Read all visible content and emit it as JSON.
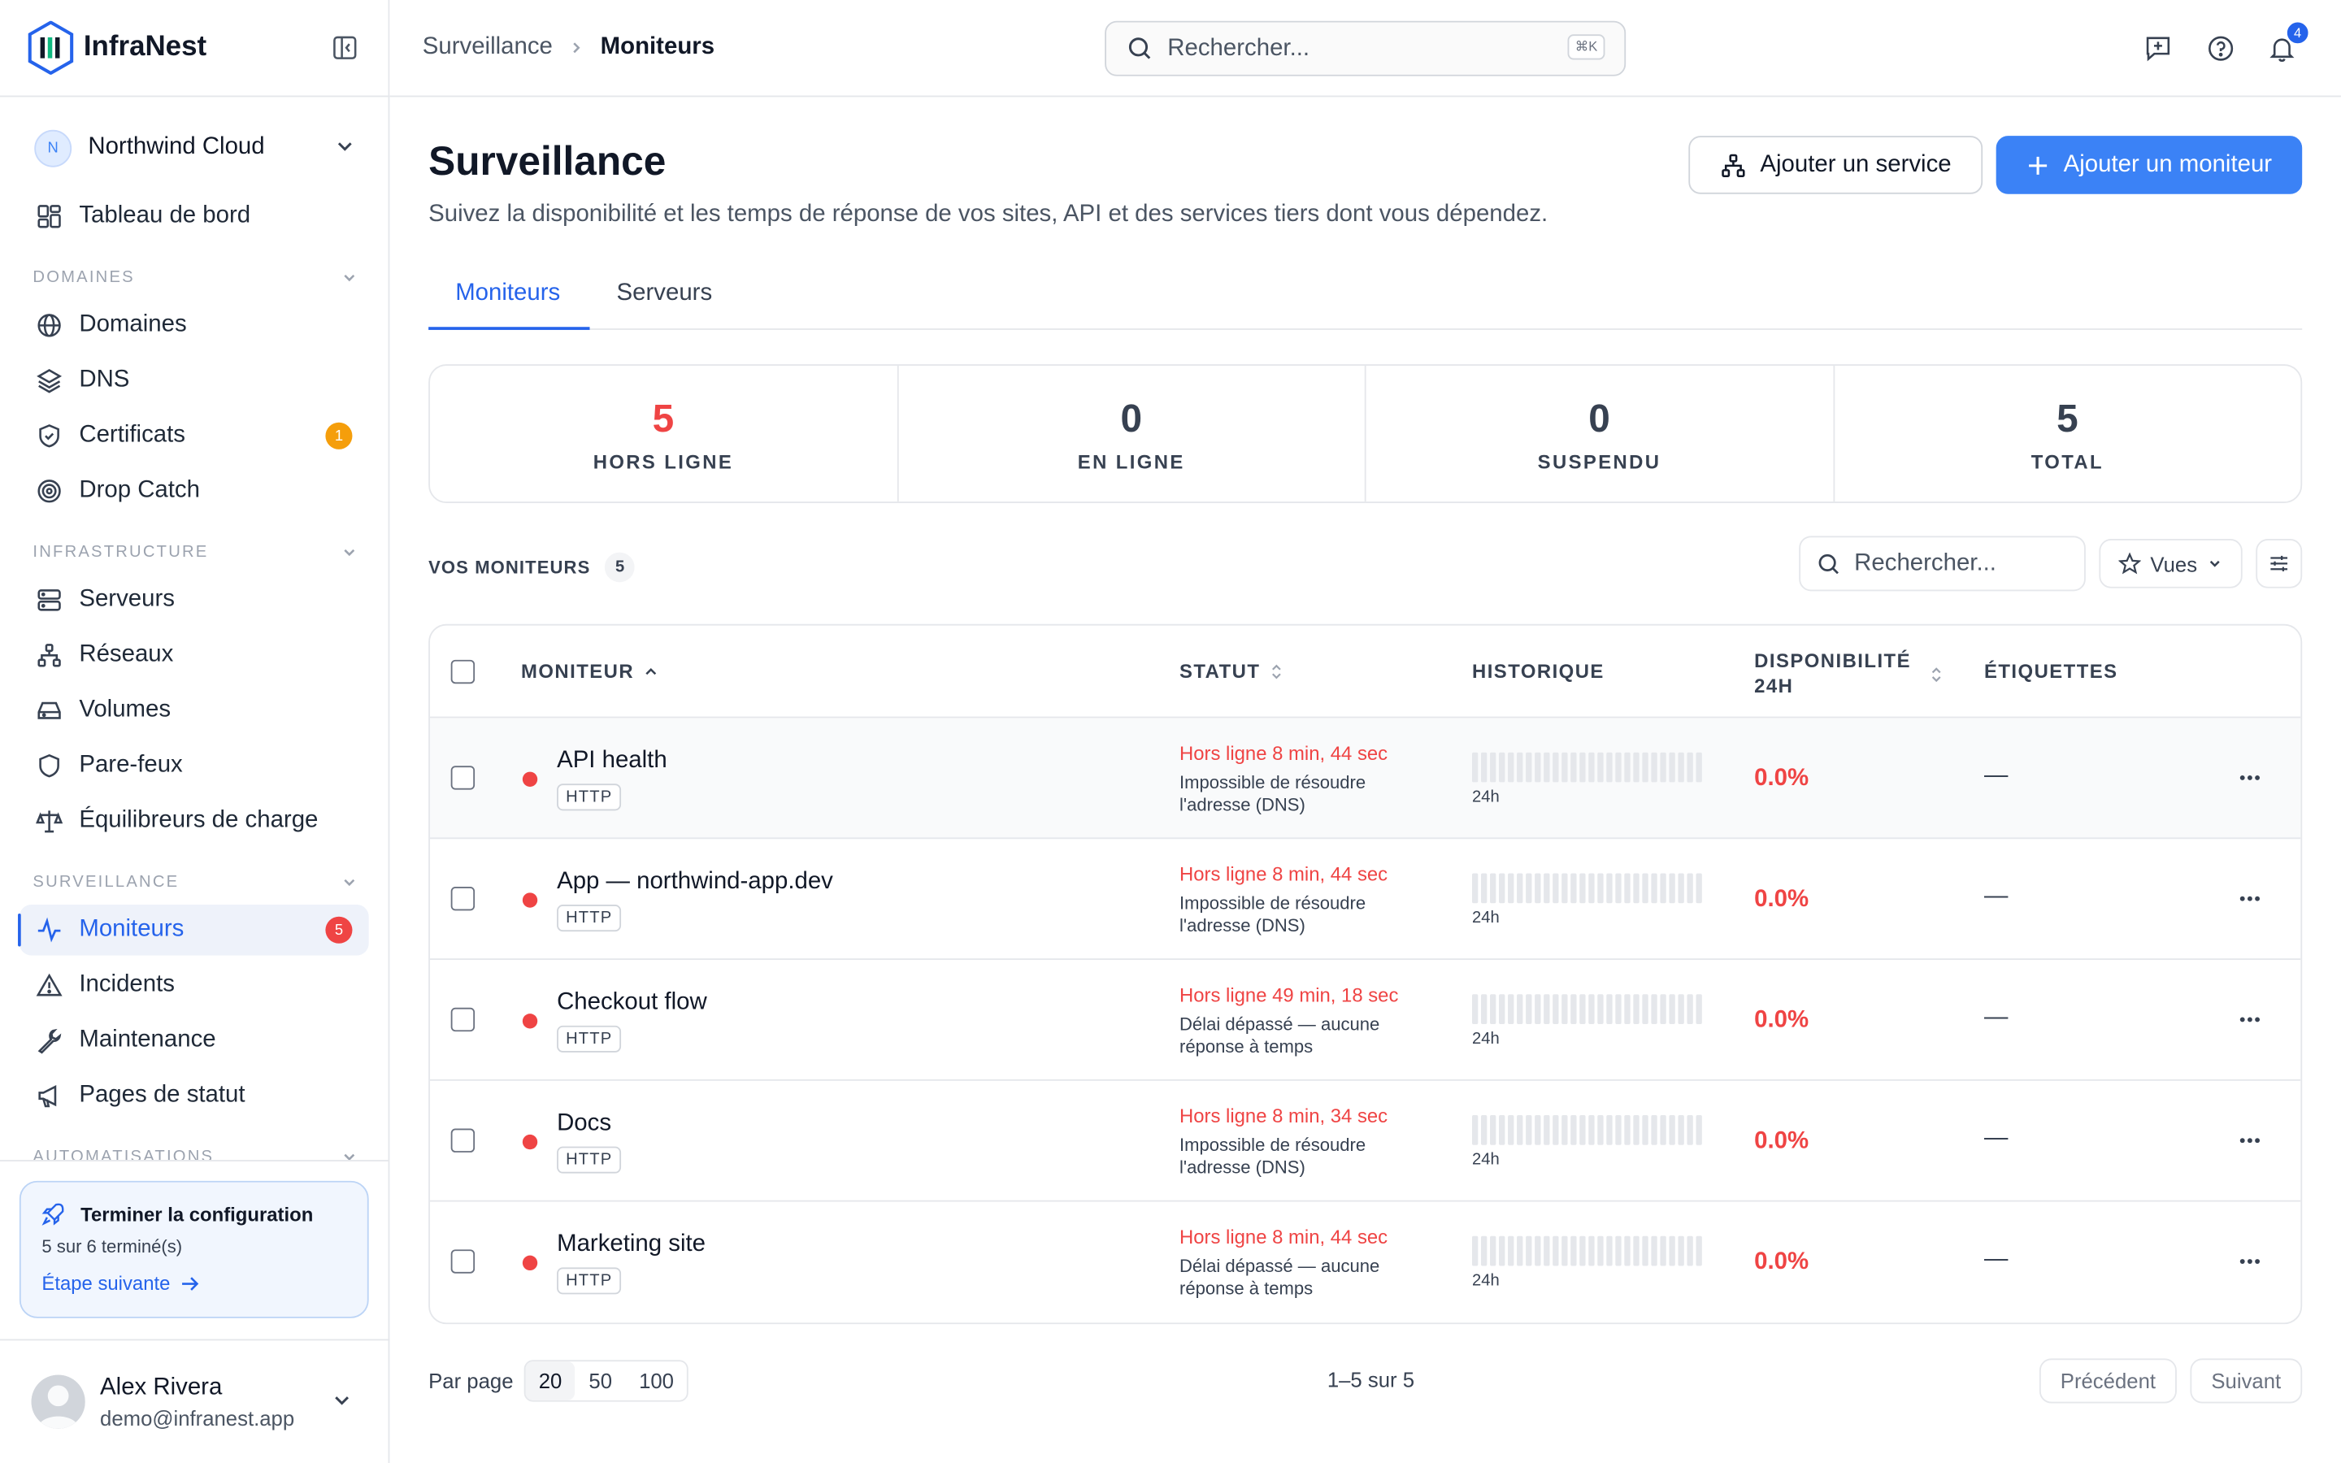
{
  "app": {
    "name": "InfraNest"
  },
  "org": {
    "initial": "N",
    "name": "Northwind Cloud"
  },
  "nav": {
    "dashboard": "Tableau de bord",
    "sections": {
      "domains": "DOMAINES",
      "infrastructure": "INFRASTRUCTURE",
      "monitoring": "SURVEILLANCE",
      "automations": "AUTOMATISATIONS"
    },
    "items": {
      "domains": "Domaines",
      "dns": "DNS",
      "certificates": "Certificats",
      "certificates_badge": "1",
      "drop_catch": "Drop Catch",
      "servers": "Serveurs",
      "networks": "Réseaux",
      "volumes": "Volumes",
      "firewalls": "Pare-feux",
      "load_balancers": "Équilibreurs de charge",
      "monitors": "Moniteurs",
      "monitors_badge": "5",
      "incidents": "Incidents",
      "maintenance": "Maintenance",
      "status_pages": "Pages de statut"
    }
  },
  "setup": {
    "title": "Terminer la configuration",
    "progress": "5 sur 6 terminé(s)",
    "next": "Étape suivante"
  },
  "user": {
    "name": "Alex Rivera",
    "email": "demo@infranest.app"
  },
  "topbar": {
    "breadcrumb": [
      "Surveillance",
      "Moniteurs"
    ],
    "search_placeholder": "Rechercher...",
    "shortcut": "⌘K",
    "notifications_count": "4"
  },
  "page": {
    "title": "Surveillance",
    "subtitle": "Suivez la disponibilité et les temps de réponse de vos sites, API et des services tiers dont vous dépendez.",
    "add_service": "Ajouter un service",
    "add_monitor": "Ajouter un moniteur",
    "tabs": [
      "Moniteurs",
      "Serveurs"
    ]
  },
  "stats": [
    {
      "value": "5",
      "label": "HORS LIGNE",
      "color": "#ef4444"
    },
    {
      "value": "0",
      "label": "EN LIGNE",
      "color": "#374151"
    },
    {
      "value": "0",
      "label": "SUSPENDU",
      "color": "#374151"
    },
    {
      "value": "5",
      "label": "TOTAL",
      "color": "#374151"
    }
  ],
  "list": {
    "heading": "VOS MONITEURS",
    "count": "5",
    "search_placeholder": "Rechercher...",
    "views": "Vues"
  },
  "table": {
    "columns": {
      "monitor": "MONITEUR",
      "status": "STATUT",
      "history": "HISTORIQUE",
      "uptime_line1": "DISPONIBILITÉ",
      "uptime_line2": "24H",
      "tags": "ÉTIQUETTES"
    },
    "rows": [
      {
        "name": "API health",
        "type": "HTTP",
        "status": "Hors ligne 8 min, 44 sec",
        "detail": "Impossible de résoudre l'adresse (DNS)",
        "history_label": "24h",
        "uptime": "0.0%",
        "tags": "—"
      },
      {
        "name": "App — northwind-app.dev",
        "type": "HTTP",
        "status": "Hors ligne 8 min, 44 sec",
        "detail": "Impossible de résoudre l'adresse (DNS)",
        "history_label": "24h",
        "uptime": "0.0%",
        "tags": "—"
      },
      {
        "name": "Checkout flow",
        "type": "HTTP",
        "status": "Hors ligne 49 min, 18 sec",
        "detail": "Délai dépassé — aucune réponse à temps",
        "history_label": "24h",
        "uptime": "0.0%",
        "tags": "—"
      },
      {
        "name": "Docs",
        "type": "HTTP",
        "status": "Hors ligne 8 min, 34 sec",
        "detail": "Impossible de résoudre l'adresse (DNS)",
        "history_label": "24h",
        "uptime": "0.0%",
        "tags": "—"
      },
      {
        "name": "Marketing site",
        "type": "HTTP",
        "status": "Hors ligne 8 min, 44 sec",
        "detail": "Délai dépassé — aucune réponse à temps",
        "history_label": "24h",
        "uptime": "0.0%",
        "tags": "—"
      }
    ]
  },
  "pagination": {
    "per_page_label": "Par page",
    "options": [
      "20",
      "50",
      "100"
    ],
    "range": "1–5 sur 5",
    "prev": "Précédent",
    "next": "Suivant"
  },
  "colors": {
    "accent": "#3b82f6",
    "danger": "#ef4444",
    "warning": "#f59e0b"
  }
}
